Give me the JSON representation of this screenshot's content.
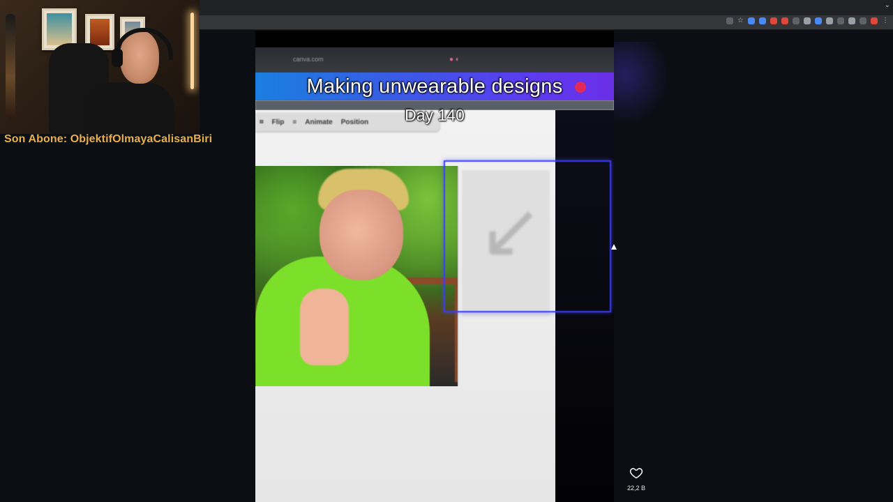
{
  "stream": {
    "caption": "Son Abone: ObjektifOlmayaCalisanBiri"
  },
  "video": {
    "url_text": "canva.com",
    "title": "Making unwearable designs",
    "day": "Day 140",
    "toolbar": {
      "flip": "Flip",
      "animate": "Animate",
      "position": "Position"
    }
  },
  "actions": {
    "like_count": "22,2 B"
  },
  "colors": {
    "caption": "#e8b04a",
    "selection": "#3a3aff",
    "canva_gradient_start": "#1a7fe0",
    "canva_gradient_end": "#6a2fe8"
  },
  "icons": [
    "heart-icon",
    "star-icon",
    "kebab-menu-icon"
  ]
}
